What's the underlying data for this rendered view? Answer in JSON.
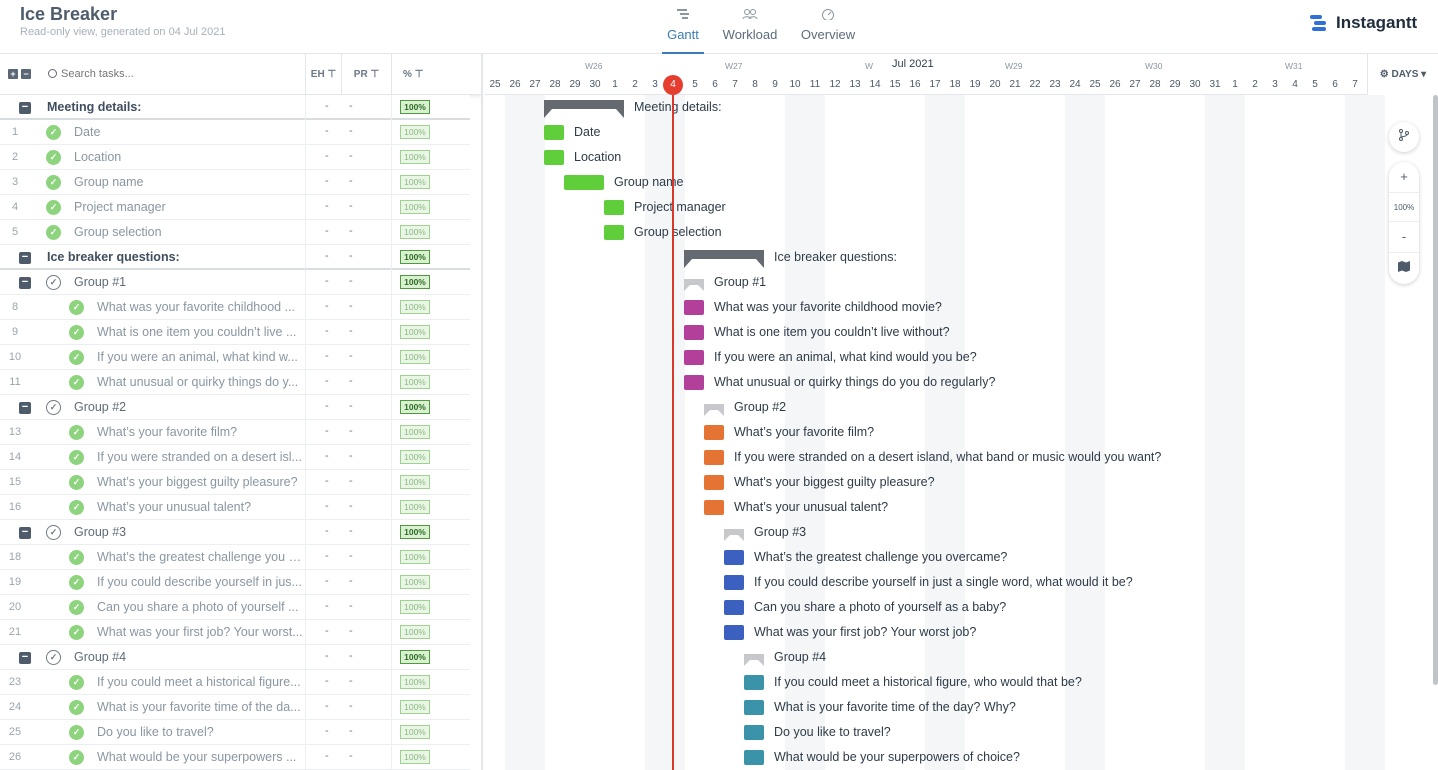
{
  "app": {
    "title": "Ice Breaker",
    "subtitle": "Read-only view, generated on 04 Jul 2021",
    "logo_text": "Instagantt"
  },
  "nav": [
    {
      "label": "Gantt",
      "icon": "gantt-icon",
      "active": true
    },
    {
      "label": "Workload",
      "icon": "people-icon",
      "active": false
    },
    {
      "label": "Overview",
      "icon": "dashboard-icon",
      "active": false
    }
  ],
  "list": {
    "search_placeholder": "Search tasks...",
    "col_eh": "EH",
    "col_pr": "PR",
    "col_pct": "%",
    "rows": [
      {
        "num": "",
        "name": "Meeting details:",
        "type": "section",
        "eh": "-",
        "pr": "-",
        "pct": "100%"
      },
      {
        "num": "1",
        "name": "Date",
        "type": "task",
        "eh": "-",
        "pr": "-",
        "pct": "100%"
      },
      {
        "num": "2",
        "name": "Location",
        "type": "task",
        "eh": "-",
        "pr": "-",
        "pct": "100%"
      },
      {
        "num": "3",
        "name": "Group name",
        "type": "task",
        "eh": "-",
        "pr": "-",
        "pct": "100%"
      },
      {
        "num": "4",
        "name": "Project manager",
        "type": "task",
        "eh": "-",
        "pr": "-",
        "pct": "100%"
      },
      {
        "num": "5",
        "name": "Group selection",
        "type": "task",
        "eh": "-",
        "pr": "-",
        "pct": "100%"
      },
      {
        "num": "",
        "name": "Ice breaker questions:",
        "type": "section",
        "eh": "-",
        "pr": "-",
        "pct": "100%"
      },
      {
        "num": "",
        "name": "Group #1",
        "type": "group",
        "eh": "-",
        "pr": "-",
        "pct": "100%"
      },
      {
        "num": "8",
        "name": "What was your favorite childhood ...",
        "type": "sub",
        "eh": "-",
        "pr": "-",
        "pct": "100%"
      },
      {
        "num": "9",
        "name": "What is one item you couldn’t live ...",
        "type": "sub",
        "eh": "-",
        "pr": "-",
        "pct": "100%"
      },
      {
        "num": "10",
        "name": "If you were an animal, what kind w...",
        "type": "sub",
        "eh": "-",
        "pr": "-",
        "pct": "100%"
      },
      {
        "num": "11",
        "name": "What unusual or quirky things do y...",
        "type": "sub",
        "eh": "-",
        "pr": "-",
        "pct": "100%"
      },
      {
        "num": "",
        "name": "Group #2",
        "type": "group",
        "eh": "-",
        "pr": "-",
        "pct": "100%"
      },
      {
        "num": "13",
        "name": "What’s your favorite film?",
        "type": "sub",
        "eh": "-",
        "pr": "-",
        "pct": "100%"
      },
      {
        "num": "14",
        "name": "If you were stranded on a desert isl...",
        "type": "sub",
        "eh": "-",
        "pr": "-",
        "pct": "100%"
      },
      {
        "num": "15",
        "name": "What’s your biggest guilty pleasure?",
        "type": "sub",
        "eh": "-",
        "pr": "-",
        "pct": "100%"
      },
      {
        "num": "16",
        "name": "What’s your unusual talent?",
        "type": "sub",
        "eh": "-",
        "pr": "-",
        "pct": "100%"
      },
      {
        "num": "",
        "name": "Group #3",
        "type": "group",
        "eh": "-",
        "pr": "-",
        "pct": "100%"
      },
      {
        "num": "18",
        "name": "What’s the greatest challenge you o...",
        "type": "sub",
        "eh": "-",
        "pr": "-",
        "pct": "100%"
      },
      {
        "num": "19",
        "name": "If you could describe yourself in jus...",
        "type": "sub",
        "eh": "-",
        "pr": "-",
        "pct": "100%"
      },
      {
        "num": "20",
        "name": "Can you share a photo of yourself ...",
        "type": "sub",
        "eh": "-",
        "pr": "-",
        "pct": "100%"
      },
      {
        "num": "21",
        "name": "What was your first job? Your worst...",
        "type": "sub",
        "eh": "-",
        "pr": "-",
        "pct": "100%"
      },
      {
        "num": "",
        "name": "Group #4",
        "type": "group",
        "eh": "-",
        "pr": "-",
        "pct": "100%"
      },
      {
        "num": "23",
        "name": "If you could meet a historical figure...",
        "type": "sub",
        "eh": "-",
        "pr": "-",
        "pct": "100%"
      },
      {
        "num": "24",
        "name": "What is your favorite time of the da...",
        "type": "sub",
        "eh": "-",
        "pr": "-",
        "pct": "100%"
      },
      {
        "num": "25",
        "name": "Do you like to travel?",
        "type": "sub",
        "eh": "-",
        "pr": "-",
        "pct": "100%"
      },
      {
        "num": "26",
        "name": "What would be your superpowers ...",
        "type": "sub",
        "eh": "-",
        "pr": "-",
        "pct": "100%"
      }
    ]
  },
  "timeline": {
    "month_label": "Jul 2021",
    "weeks": [
      "W26",
      "W27",
      "W",
      "W29",
      "W30",
      "W31"
    ],
    "days": [
      "25",
      "26",
      "27",
      "28",
      "29",
      "30",
      "1",
      "2",
      "3",
      "4",
      "5",
      "6",
      "7",
      "8",
      "9",
      "10",
      "11",
      "12",
      "13",
      "14",
      "15",
      "16",
      "17",
      "18",
      "19",
      "20",
      "21",
      "22",
      "23",
      "24",
      "25",
      "26",
      "27",
      "28",
      "29",
      "30",
      "31",
      "1",
      "2",
      "3",
      "4",
      "5",
      "6",
      "7"
    ],
    "today": "4",
    "scale_label": "DAYS",
    "zoom": "100%",
    "items": [
      {
        "label": "Meeting details:",
        "kind": "summary",
        "color": ""
      },
      {
        "label": "Date",
        "kind": "bar",
        "color": "#5fce3a"
      },
      {
        "label": "Location",
        "kind": "bar",
        "color": "#5fce3a"
      },
      {
        "label": "Group name",
        "kind": "bar",
        "color": "#5fce3a"
      },
      {
        "label": "Project manager",
        "kind": "bar",
        "color": "#5fce3a"
      },
      {
        "label": "Group selection",
        "kind": "bar",
        "color": "#5fce3a"
      },
      {
        "label": "Ice breaker questions:",
        "kind": "summary",
        "color": ""
      },
      {
        "label": "Group #1",
        "kind": "group",
        "color": ""
      },
      {
        "label": "What was your favorite childhood movie?",
        "kind": "bar",
        "color": "#b23f9a"
      },
      {
        "label": "What is one item you couldn’t live without?",
        "kind": "bar",
        "color": "#b23f9a"
      },
      {
        "label": "If you were an animal, what kind would you be?",
        "kind": "bar",
        "color": "#b23f9a"
      },
      {
        "label": "What unusual or quirky things do you do regularly?",
        "kind": "bar",
        "color": "#b23f9a"
      },
      {
        "label": "Group #2",
        "kind": "group",
        "color": ""
      },
      {
        "label": "What’s your favorite film?",
        "kind": "bar",
        "color": "#e57333"
      },
      {
        "label": "If you were stranded on a desert island, what band or music would you want?",
        "kind": "bar",
        "color": "#e57333"
      },
      {
        "label": "What’s your biggest guilty pleasure?",
        "kind": "bar",
        "color": "#e57333"
      },
      {
        "label": "What’s your unusual talent?",
        "kind": "bar",
        "color": "#e57333"
      },
      {
        "label": "Group #3",
        "kind": "group",
        "color": ""
      },
      {
        "label": "What’s the greatest challenge you overcame?",
        "kind": "bar",
        "color": "#3c60c0"
      },
      {
        "label": "If you could describe yourself in just a single word, what would it be?",
        "kind": "bar",
        "color": "#3c60c0"
      },
      {
        "label": "Can you share a photo of yourself as a baby?",
        "kind": "bar",
        "color": "#3c60c0"
      },
      {
        "label": "What was your first job? Your worst job?",
        "kind": "bar",
        "color": "#3c60c0"
      },
      {
        "label": "Group #4",
        "kind": "group",
        "color": ""
      },
      {
        "label": "If you could meet a historical figure, who would that be?",
        "kind": "bar",
        "color": "#3a93a8"
      },
      {
        "label": "What is your favorite time of the day? Why?",
        "kind": "bar",
        "color": "#3a93a8"
      },
      {
        "label": "Do you like to travel?",
        "kind": "bar",
        "color": "#3a93a8"
      },
      {
        "label": "What would be your superpowers of choice?",
        "kind": "bar",
        "color": "#3a93a8"
      }
    ]
  },
  "tools": {
    "plus": "+",
    "minus": "-"
  }
}
